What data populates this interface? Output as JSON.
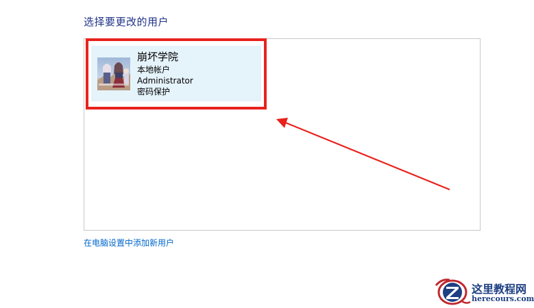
{
  "heading": "选择要更改的用户",
  "account": {
    "name": "崩坏学院",
    "type": "本地帐户",
    "role": "Administrator",
    "protection": "密码保护"
  },
  "add_user_link": "在电脑设置中添加新用户",
  "watermark": {
    "title": "这里教程网",
    "url": "herecours.com"
  },
  "colors": {
    "heading": "#1e3287",
    "tile_background": "#e5f3fb",
    "annotation_red": "#e8231d",
    "link": "#0066cc",
    "watermark_blue": "#1e3f82",
    "watermark_red": "#c0282e"
  }
}
